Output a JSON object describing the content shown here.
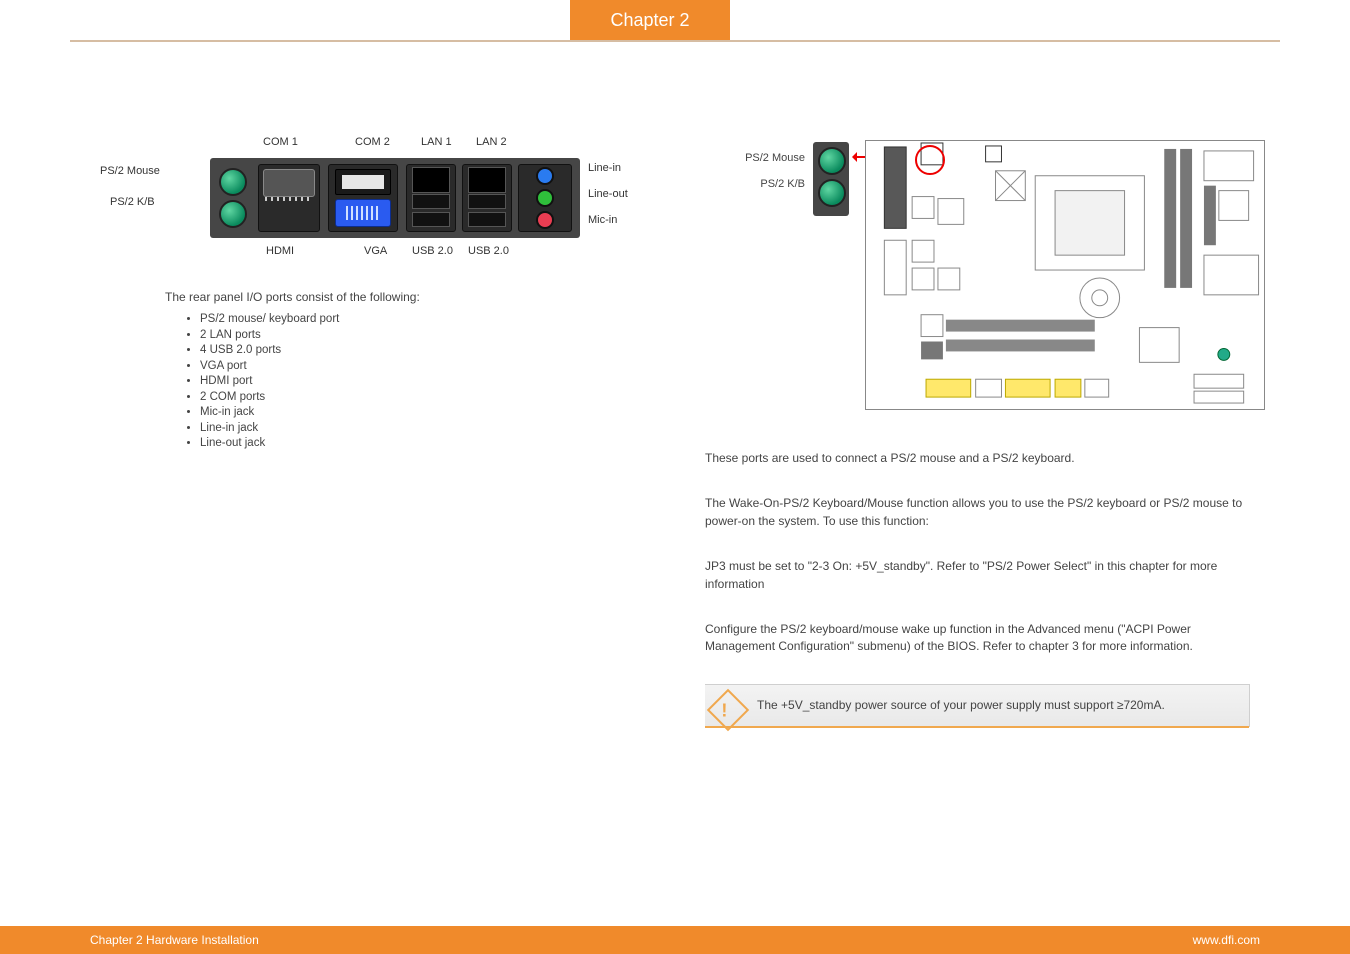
{
  "header": {
    "chapter_tab": "Chapter 2"
  },
  "footer": {
    "left": "Chapter 2 Hardware Installation",
    "right": "www.dfi.com"
  },
  "rear_panel": {
    "ps2_mouse_label": "PS/2 Mouse",
    "ps2_kb_label": "PS/2 K/B",
    "com1_label": "COM 1",
    "com2_label": "COM 2",
    "lan1_label": "LAN 1",
    "lan2_label": "LAN 2",
    "hdmi_label": "HDMI",
    "vga_label": "VGA",
    "usb20_label_1": "USB 2.0",
    "usb20_label_2": "USB 2.0",
    "linein_label": "Line-in",
    "lineout_label": "Line-out",
    "micin_label": "Mic-in"
  },
  "left_column": {
    "intro": "The rear panel I/O ports consist of the following:",
    "ports": [
      "PS/2 mouse/ keyboard port",
      "2 LAN ports",
      "4 USB 2.0 ports",
      "VGA port",
      "HDMI port",
      "2 COM ports",
      "Mic-in jack",
      "Line-in jack",
      "Line-out jack"
    ]
  },
  "right_column": {
    "ps2_mouse_label": "PS/2 Mouse",
    "ps2_kb_label": "PS/2 K/B",
    "para1": "These ports are used to connect a PS/2 mouse and a PS/2 keyboard.",
    "para2": "The Wake-On-PS/2 Keyboard/Mouse function allows you to use the PS/2 keyboard or PS/2 mouse to power-on the system. To use this function:",
    "para3": "JP3 must be set to \"2-3 On: +5V_standby\". Refer to \"PS/2 Power Select\" in this chapter for more information",
    "para4": "Configure the PS/2 keyboard/mouse wake up function in the Advanced menu (\"ACPI Power Management Configuration\" submenu) of the BIOS. Refer to chapter 3 for more information.",
    "note": "The +5V_standby power source of your power supply must support ≥720mA."
  }
}
